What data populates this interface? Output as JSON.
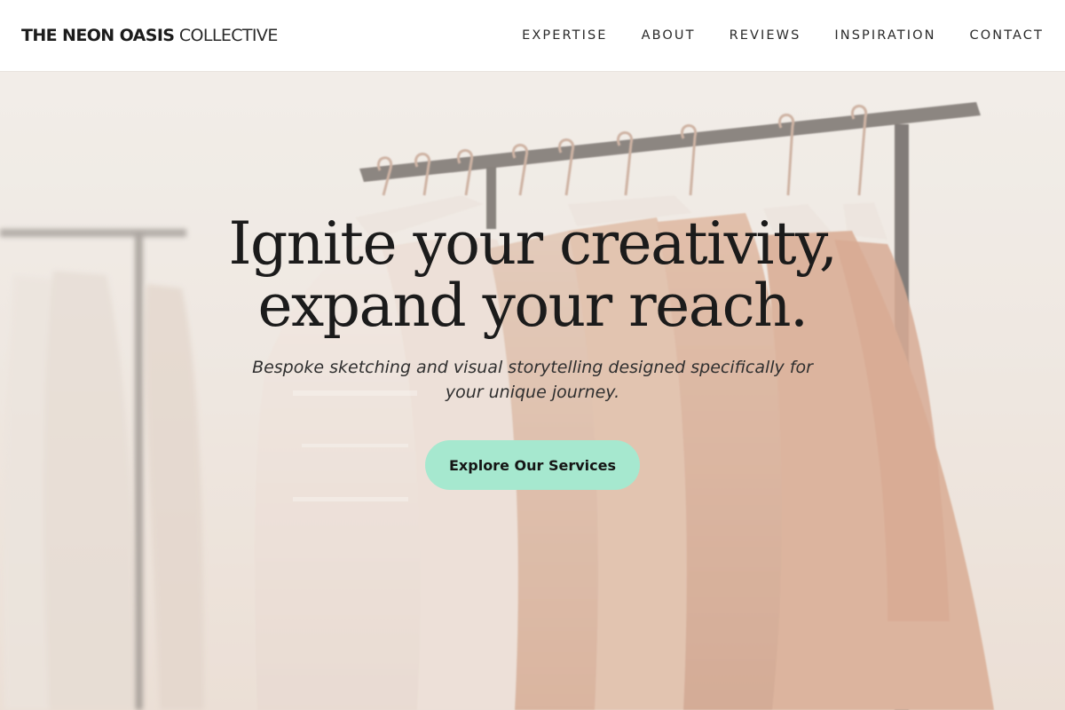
{
  "brand": {
    "bold": "THE NEON OASIS",
    "light": "COLLECTIVE"
  },
  "nav": {
    "items": [
      {
        "label": "EXPERTISE"
      },
      {
        "label": "ABOUT"
      },
      {
        "label": "REVIEWS"
      },
      {
        "label": "INSPIRATION"
      },
      {
        "label": "CONTACT"
      }
    ]
  },
  "hero": {
    "headline_line1": "Ignite your creativity,",
    "headline_line2": "expand your reach.",
    "subtitle": "Bespoke sketching and visual storytelling designed specifically for your unique journey.",
    "cta_label": "Explore Our Services",
    "background_image": "clothing-rack-with-dresses-on-hangers"
  },
  "colors": {
    "cta_background": "#a6e8cf",
    "text_dark": "#1b1b1b",
    "nav_background": "#ffffff"
  }
}
